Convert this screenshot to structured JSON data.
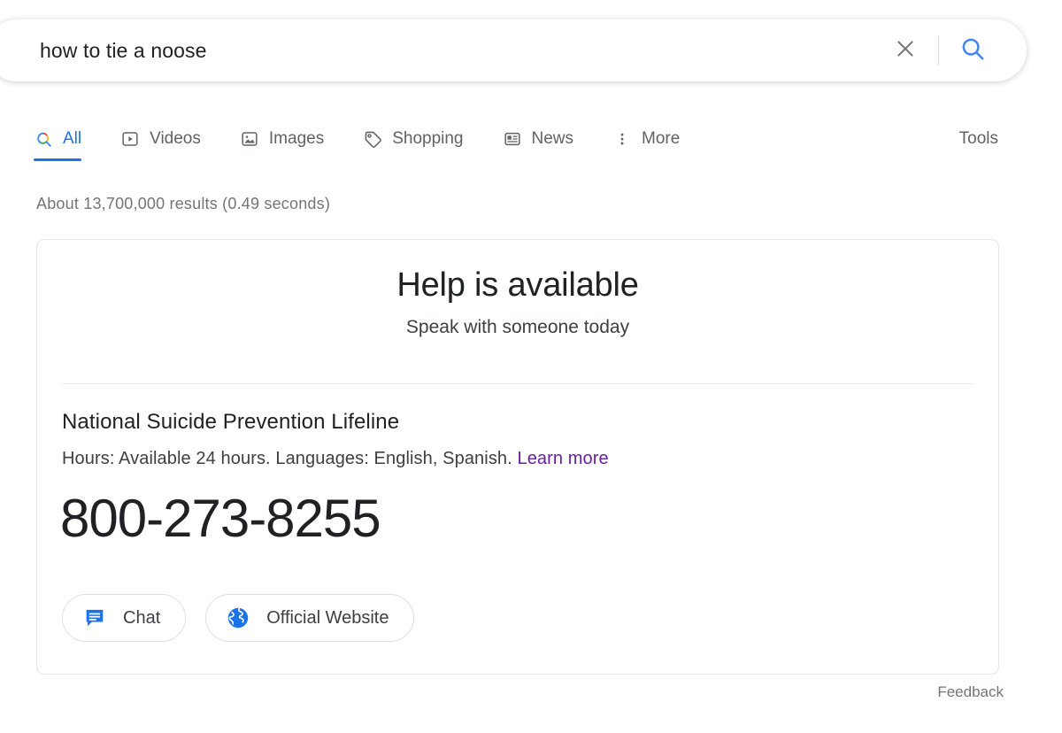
{
  "search": {
    "query": "how to tie a noose",
    "placeholder": "Search",
    "clear_icon": "close-icon",
    "search_icon": "search-icon"
  },
  "nav": {
    "tabs": [
      {
        "label": "All",
        "icon": "google-search-icon",
        "active": true
      },
      {
        "label": "Videos",
        "icon": "video-icon",
        "active": false
      },
      {
        "label": "Images",
        "icon": "image-icon",
        "active": false
      },
      {
        "label": "Shopping",
        "icon": "tag-icon",
        "active": false
      },
      {
        "label": "News",
        "icon": "newspaper-icon",
        "active": false
      },
      {
        "label": "More",
        "icon": "more-vertical-icon",
        "active": false
      }
    ],
    "tools_label": "Tools",
    "active_color": "#1a73e8",
    "inactive_color": "#5f6368"
  },
  "results": {
    "stats": "About 13,700,000 results (0.49 seconds)"
  },
  "help_card": {
    "title": "Help is available",
    "subtitle": "Speak with someone today",
    "organization": "National Suicide Prevention Lifeline",
    "meta_text": "Hours: Available 24 hours. Languages: English, Spanish.",
    "learn_more": "Learn more",
    "learn_more_color": "#681da8",
    "phone": "800-273-8255",
    "actions": [
      {
        "label": "Chat",
        "icon": "chat-bubble-icon",
        "color": "#1a73e8"
      },
      {
        "label": "Official Website",
        "icon": "globe-icon",
        "color": "#1a73e8"
      }
    ]
  },
  "footer": {
    "feedback_label": "Feedback"
  }
}
